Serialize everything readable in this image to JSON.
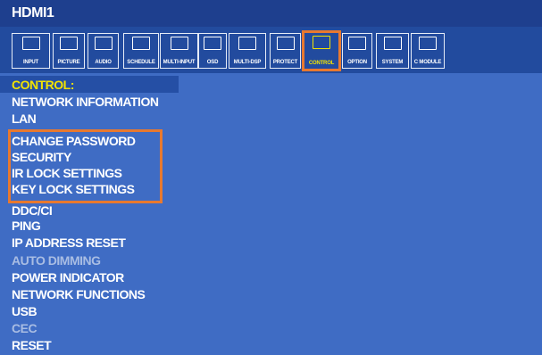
{
  "window": {
    "source": "HDMI1"
  },
  "toolbar": {
    "tabs": [
      {
        "label": "INPUT",
        "icon": "input-icon"
      },
      {
        "label": "PICTURE",
        "icon": "picture-icon"
      },
      {
        "label": "AUDIO",
        "icon": "audio-icon"
      },
      {
        "label": "SCHEDULE",
        "icon": "schedule-icon"
      },
      {
        "label": "MULTI-INPUT",
        "icon": "multi-input-icon"
      },
      {
        "label": "OSD",
        "icon": "osd-icon"
      },
      {
        "label": "MULTI-DSP",
        "icon": "multi-dsp-icon"
      },
      {
        "label": "PROTECT",
        "icon": "protect-icon"
      },
      {
        "label": "CONTROL",
        "icon": "control-icon",
        "active": true
      },
      {
        "label": "OPTION",
        "icon": "option-icon"
      },
      {
        "label": "SYSTEM",
        "icon": "system-icon"
      },
      {
        "label": "C MODULE",
        "icon": "c-module-icon"
      }
    ]
  },
  "menu": {
    "title": "CONTROL:",
    "items": [
      {
        "label": "NETWORK INFORMATION",
        "enabled": true
      },
      {
        "label": "LAN",
        "enabled": true
      },
      {
        "label": "CHANGE PASSWORD",
        "enabled": true
      },
      {
        "label": "SECURITY",
        "enabled": true
      },
      {
        "label": "IR LOCK SETTINGS",
        "enabled": true
      },
      {
        "label": "KEY LOCK SETTINGS",
        "enabled": true
      },
      {
        "label": "DDC/CI",
        "enabled": true
      },
      {
        "label": "PING",
        "enabled": true
      },
      {
        "label": "IP ADDRESS RESET",
        "enabled": true
      },
      {
        "label": "AUTO DIMMING",
        "enabled": false
      },
      {
        "label": "POWER INDICATOR",
        "enabled": true
      },
      {
        "label": "NETWORK FUNCTIONS",
        "enabled": true
      },
      {
        "label": "USB",
        "enabled": true
      },
      {
        "label": "CEC",
        "enabled": false
      },
      {
        "label": "RESET",
        "enabled": true
      }
    ]
  },
  "colors": {
    "background": "#3f6cc4",
    "title_bar": "#1e3f8e",
    "highlight_text": "#f2e300",
    "callout_border": "#e8792f",
    "disabled_text": "#a9bde3"
  }
}
